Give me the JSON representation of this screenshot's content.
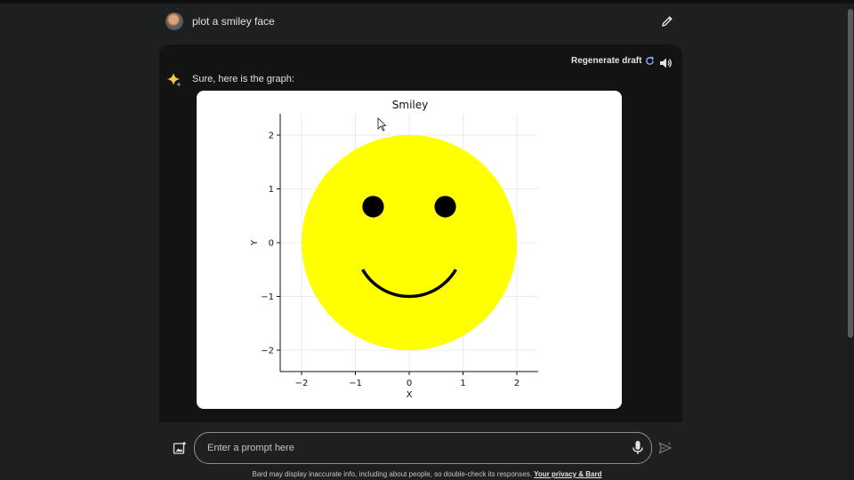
{
  "user_prompt": {
    "text": "plot a smiley face"
  },
  "response": {
    "regenerate_label": "Regenerate draft",
    "text": "Sure, here is the graph:"
  },
  "chart_data": {
    "type": "scatter",
    "title": "Smiley",
    "xlabel": "X",
    "ylabel": "Y",
    "xlim": [
      -2.4,
      2.4
    ],
    "ylim": [
      -2.4,
      2.4
    ],
    "xticks": [
      -2,
      -1,
      0,
      1,
      2
    ],
    "yticks": [
      -2,
      -1,
      0,
      1,
      2
    ],
    "xtick_labels": [
      "−2",
      "−1",
      "0",
      "1",
      "2"
    ],
    "ytick_labels": [
      "2",
      "1",
      "0",
      "−1",
      "−2"
    ],
    "grid": true,
    "face": {
      "center": [
        0,
        0
      ],
      "radius": 2,
      "color": "#ffff00"
    },
    "eyes": [
      {
        "center": [
          -0.67,
          0.67
        ],
        "radius": 0.2,
        "color": "#000000"
      },
      {
        "center": [
          0.67,
          0.67
        ],
        "radius": 0.2,
        "color": "#000000"
      }
    ],
    "mouth": {
      "center": [
        0,
        0
      ],
      "radius": 1,
      "theta_deg": [
        210,
        330
      ],
      "color": "#000000"
    }
  },
  "prompt_bar": {
    "placeholder": "Enter a prompt here"
  },
  "footer": {
    "disclaimer": "Bard may display inaccurate info, including about people, so double-check its responses.",
    "privacy_link": "Your privacy & Bard"
  },
  "colors": {
    "background": "#1e1f20",
    "panel": "#131314",
    "accent_blue": "#8ab4f8"
  },
  "icons": [
    "avatar",
    "edit-icon",
    "refresh-icon",
    "speaker-icon",
    "sparkle-icon",
    "add-image-icon",
    "mic-icon",
    "send-icon"
  ]
}
